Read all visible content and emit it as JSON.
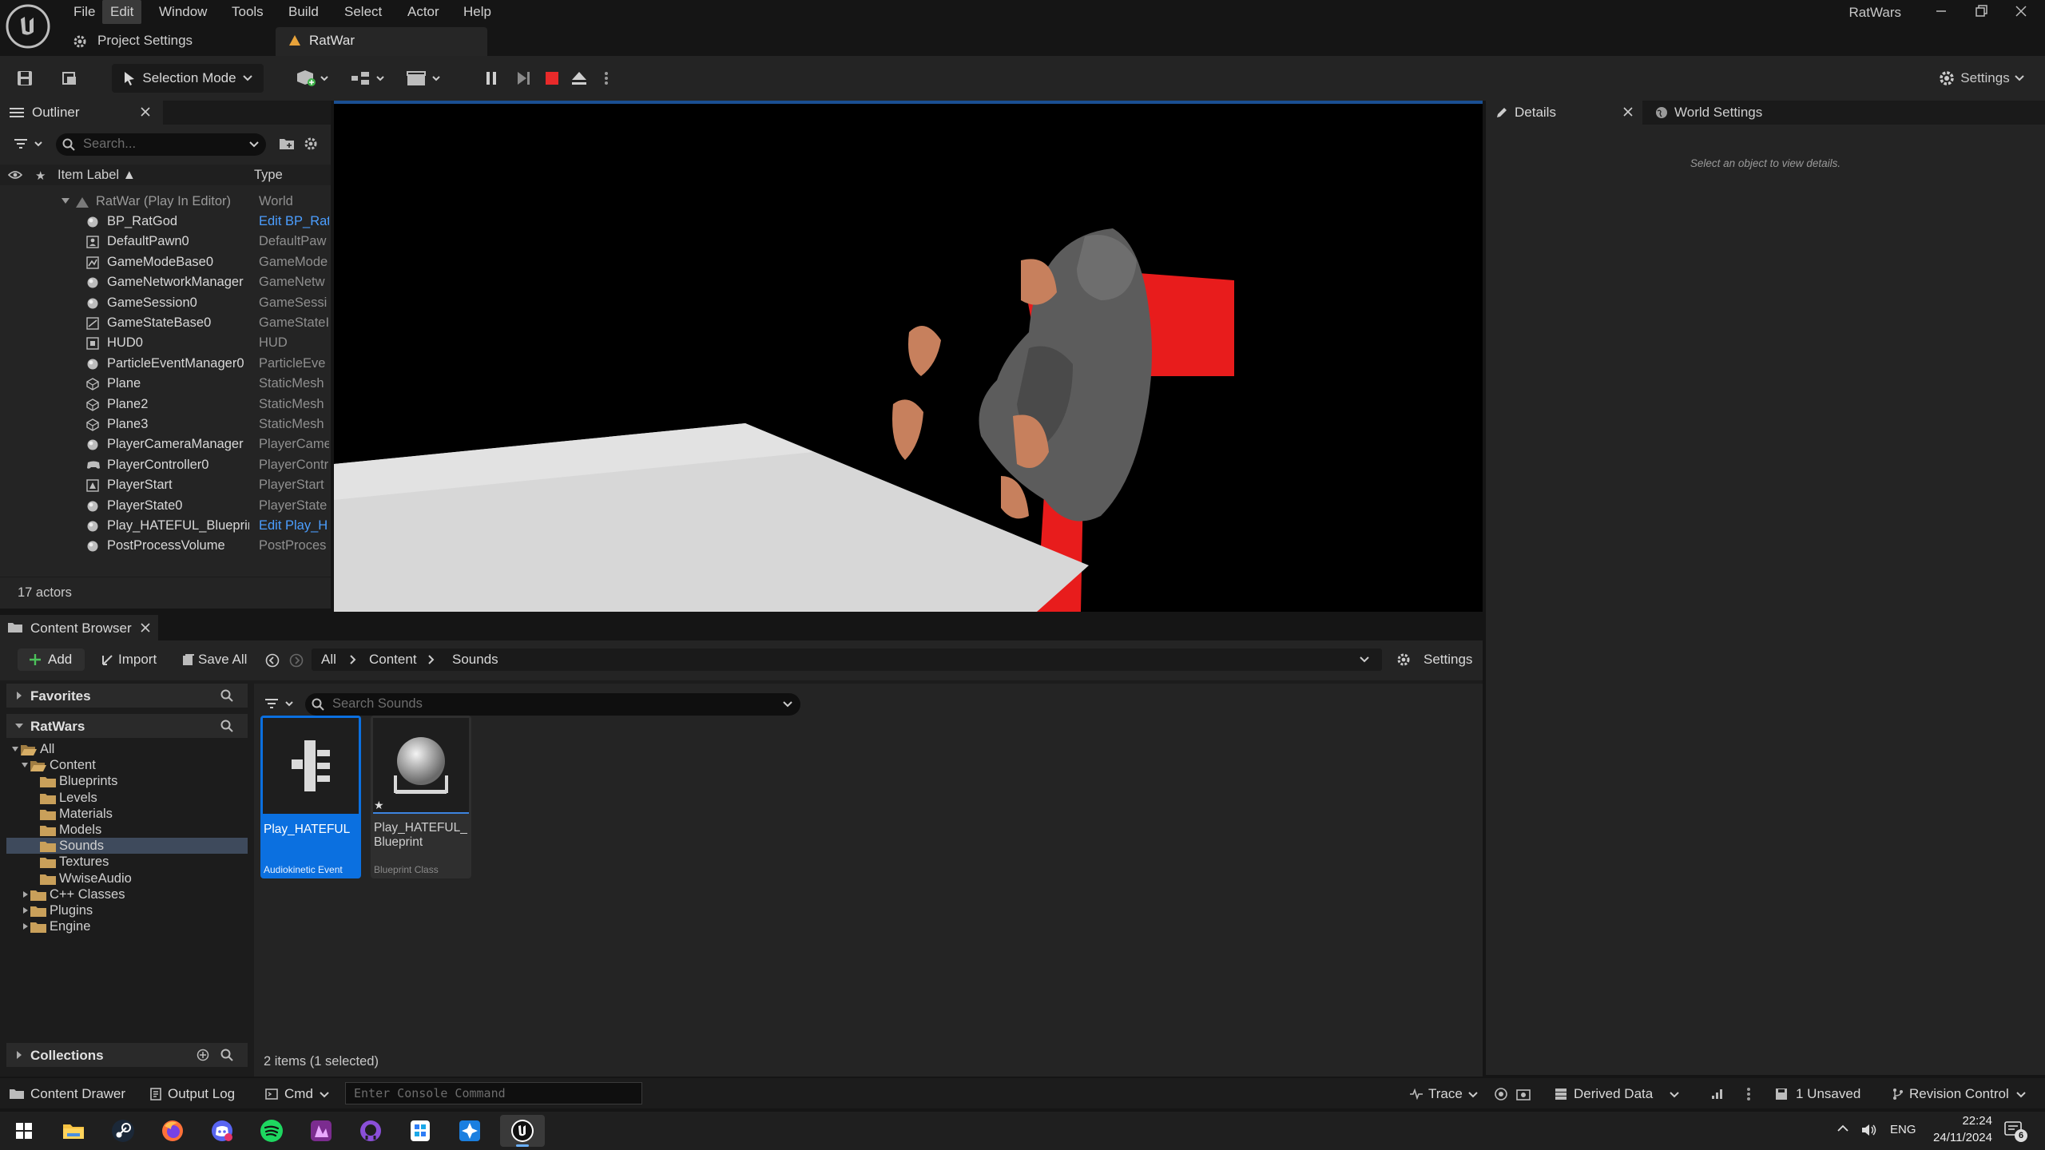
{
  "app": {
    "title": "RatWars",
    "menu": [
      "File",
      "Edit",
      "Window",
      "Tools",
      "Build",
      "Select",
      "Actor",
      "Help"
    ],
    "active_menu": "Edit",
    "tabs": {
      "project_settings": "Project Settings",
      "level": "RatWar"
    }
  },
  "toolbar": {
    "selection_mode": "Selection Mode",
    "settings": "Settings"
  },
  "outliner": {
    "tab": "Outliner",
    "search_placeholder": "Search...",
    "col_label": "Item Label ▲",
    "col_type": "Type",
    "world_label": "RatWar (Play In Editor)",
    "world_type": "World",
    "rows": [
      {
        "label": "BP_RatGod",
        "type": "Edit BP_Rat",
        "link": true,
        "icon": "actor"
      },
      {
        "label": "DefaultPawn0",
        "type": "DefaultPaw",
        "link": false,
        "icon": "pawn"
      },
      {
        "label": "GameModeBase0",
        "type": "GameMode",
        "link": false,
        "icon": "gamemode"
      },
      {
        "label": "GameNetworkManager",
        "type": "GameNetw",
        "link": false,
        "icon": "actor"
      },
      {
        "label": "GameSession0",
        "type": "GameSessi",
        "link": false,
        "icon": "actor"
      },
      {
        "label": "GameStateBase0",
        "type": "GameStateI",
        "link": false,
        "icon": "gamestate"
      },
      {
        "label": "HUD0",
        "type": "HUD",
        "link": false,
        "icon": "hud"
      },
      {
        "label": "ParticleEventManager0",
        "type": "ParticleEve",
        "link": false,
        "icon": "actor"
      },
      {
        "label": "Plane",
        "type": "StaticMesh",
        "link": false,
        "icon": "mesh"
      },
      {
        "label": "Plane2",
        "type": "StaticMesh",
        "link": false,
        "icon": "mesh"
      },
      {
        "label": "Plane3",
        "type": "StaticMesh",
        "link": false,
        "icon": "mesh"
      },
      {
        "label": "PlayerCameraManager",
        "type": "PlayerCame",
        "link": false,
        "icon": "actor"
      },
      {
        "label": "PlayerController0",
        "type": "PlayerContr",
        "link": false,
        "icon": "controller"
      },
      {
        "label": "PlayerStart",
        "type": "PlayerStart",
        "link": false,
        "icon": "start"
      },
      {
        "label": "PlayerState0",
        "type": "PlayerState",
        "link": false,
        "icon": "actor"
      },
      {
        "label": "Play_HATEFUL_Blueprint",
        "type": "Edit Play_H",
        "link": true,
        "icon": "actor"
      },
      {
        "label": "PostProcessVolume",
        "type": "PostProces",
        "link": false,
        "icon": "actor"
      }
    ],
    "actor_count": "17 actors"
  },
  "details": {
    "tab": "Details",
    "world_settings_tab": "World Settings",
    "empty_hint": "Select an object to view details."
  },
  "content_browser": {
    "tab": "Content Browser",
    "add": "Add",
    "import": "Import",
    "save_all": "Save All",
    "breadcrumb": [
      "All",
      "Content",
      "Sounds"
    ],
    "settings": "Settings",
    "favorites": "Favorites",
    "project": "RatWars",
    "search_placeholder": "Search Sounds",
    "tree": [
      {
        "label": "All",
        "depth": 0,
        "open": true
      },
      {
        "label": "Content",
        "depth": 1,
        "open": true
      },
      {
        "label": "Blueprints",
        "depth": 2
      },
      {
        "label": "Levels",
        "depth": 2
      },
      {
        "label": "Materials",
        "depth": 2
      },
      {
        "label": "Models",
        "depth": 2
      },
      {
        "label": "Sounds",
        "depth": 2,
        "selected": true
      },
      {
        "label": "Textures",
        "depth": 2
      },
      {
        "label": "WwiseAudio",
        "depth": 2
      },
      {
        "label": "C++ Classes",
        "depth": 1,
        "closed": true
      },
      {
        "label": "Plugins",
        "depth": 1,
        "closed": true
      },
      {
        "label": "Engine",
        "depth": 1,
        "closed": true
      }
    ],
    "assets": [
      {
        "name": "Play_HATEFUL",
        "type": "Audiokinetic Event",
        "selected": true
      },
      {
        "name": "Play_HATEFUL_\nBlueprint",
        "type": "Blueprint Class",
        "selected": false
      }
    ],
    "collections": "Collections",
    "status": "2 items (1 selected)"
  },
  "statusbar": {
    "content_drawer": "Content Drawer",
    "output_log": "Output Log",
    "cmd": "Cmd",
    "console_placeholder": "Enter Console Command",
    "trace": "Trace",
    "derived_data": "Derived Data",
    "unsaved": "1 Unsaved",
    "revision_control": "Revision Control"
  },
  "taskbar": {
    "lang": "ENG",
    "time": "22:24",
    "date": "24/11/2024",
    "notifications": "6"
  }
}
